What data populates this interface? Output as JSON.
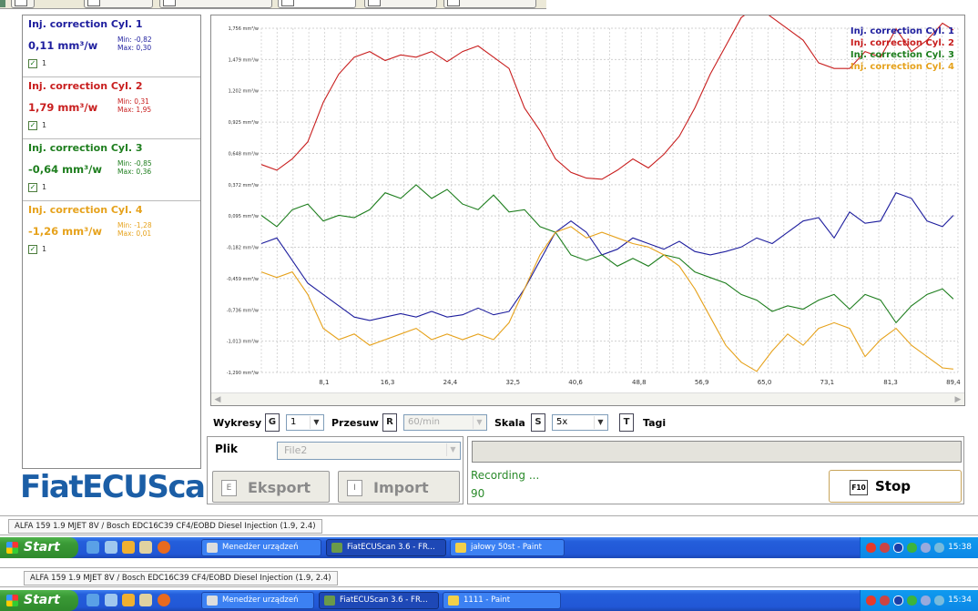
{
  "cylinders": [
    {
      "title": "Inj. correction Cyl. 1",
      "value": "0,11 mm³/w",
      "min": "Min: -0,82",
      "max": "Max: 0,30",
      "checked_label": "1",
      "color": "#1e1e9e"
    },
    {
      "title": "Inj. correction Cyl. 2",
      "value": "1,79 mm³/w",
      "min": "Min: 0,31",
      "max": "Max: 1,95",
      "checked_label": "1",
      "color": "#c81e1e"
    },
    {
      "title": "Inj. correction Cyl. 3",
      "value": "-0,64 mm³/w",
      "min": "Min: -0,85",
      "max": "Max: 0,36",
      "checked_label": "1",
      "color": "#1e7e1e"
    },
    {
      "title": "Inj. correction Cyl. 4",
      "value": "-1,26 mm³/w",
      "min": "Min: -1,28",
      "max": "Max: 0,01",
      "checked_label": "1",
      "color": "#e6a21c"
    }
  ],
  "logo": "FiatECUScan",
  "controls": {
    "wykresy_label": "Wykresy",
    "wykresy_key": "G",
    "wykresy_value": "1",
    "przesuw_label": "Przesuw",
    "przesuw_key": "R",
    "przesuw_value": "60/min",
    "skala_label": "Skala",
    "skala_key": "S",
    "skala_value": "5x",
    "tagi_key": "T",
    "tagi_label": "Tagi"
  },
  "file": {
    "label": "Plik",
    "value": "File2",
    "export_key": "E",
    "export_label": "Eksport",
    "import_key": "I",
    "import_label": "Import"
  },
  "recording": {
    "status": "Recording ...",
    "count": "90",
    "stop_key": "F10",
    "stop_label": "Stop"
  },
  "taskbars": [
    {
      "window_title": "ALFA 159 1.9 MJET 8V / Bosch EDC16C39 CF4/EOBD Diesel Injection (1.9, 2.4)",
      "start": "Start",
      "tasks": [
        "Menedżer urządzeń",
        "FiatECUScan 3.6 - FR...",
        "jałowy 50st - Paint"
      ],
      "clock": "15:38"
    },
    {
      "window_title": "ALFA 159 1.9 MJET 8V / Bosch EDC16C39 CF4/EOBD Diesel Injection (1.9, 2.4)",
      "start": "Start",
      "tasks": [
        "Menedżer urządzeń",
        "FiatECUScan 3.6 - FR...",
        "1111 - Paint"
      ],
      "clock": "15:34"
    }
  ],
  "chart_data": {
    "type": "line",
    "y_ticks": [
      "1,756 mm³/w",
      "1,479 mm³/w",
      "1,202 mm³/w",
      "0,925 mm³/w",
      "0,648 mm³/w",
      "0,372 mm³/w",
      "0,095 mm³/w",
      "-0,182 mm³/w",
      "-0,459 mm³/w",
      "-0,736 mm³/w",
      "-1,013 mm³/w",
      "-1,290 mm³/w"
    ],
    "x_ticks": [
      "8,1",
      "16,3",
      "24,4",
      "32,5",
      "40,6",
      "48,8",
      "56,9",
      "65,0",
      "73,1",
      "81,3",
      "89,4"
    ],
    "ylim": [
      -1.29,
      1.756
    ],
    "xlim": [
      0,
      90
    ],
    "grid": true,
    "legend_position": "top-right",
    "series": [
      {
        "name": "Inj. correction Cyl. 1",
        "color": "#1e1e9e",
        "points": [
          [
            0,
            -0.15
          ],
          [
            2,
            -0.1
          ],
          [
            4,
            -0.3
          ],
          [
            6,
            -0.5
          ],
          [
            8,
            -0.6
          ],
          [
            10,
            -0.7
          ],
          [
            12,
            -0.8
          ],
          [
            14,
            -0.83
          ],
          [
            16,
            -0.8
          ],
          [
            18,
            -0.77
          ],
          [
            20,
            -0.8
          ],
          [
            22,
            -0.75
          ],
          [
            24,
            -0.8
          ],
          [
            26,
            -0.78
          ],
          [
            28,
            -0.72
          ],
          [
            30,
            -0.78
          ],
          [
            32,
            -0.75
          ],
          [
            34,
            -0.55
          ],
          [
            36,
            -0.3
          ],
          [
            38,
            -0.05
          ],
          [
            40,
            0.05
          ],
          [
            42,
            -0.05
          ],
          [
            44,
            -0.25
          ],
          [
            46,
            -0.2
          ],
          [
            48,
            -0.1
          ],
          [
            50,
            -0.15
          ],
          [
            52,
            -0.2
          ],
          [
            54,
            -0.13
          ],
          [
            56,
            -0.22
          ],
          [
            58,
            -0.25
          ],
          [
            60,
            -0.22
          ],
          [
            62,
            -0.18
          ],
          [
            64,
            -0.1
          ],
          [
            66,
            -0.15
          ],
          [
            68,
            -0.05
          ],
          [
            70,
            0.05
          ],
          [
            72,
            0.08
          ],
          [
            74,
            -0.1
          ],
          [
            76,
            0.13
          ],
          [
            78,
            0.03
          ],
          [
            80,
            0.05
          ],
          [
            82,
            0.3
          ],
          [
            84,
            0.25
          ],
          [
            86,
            0.05
          ],
          [
            88,
            0.0
          ],
          [
            89.4,
            0.1
          ]
        ]
      },
      {
        "name": "Inj. correction Cyl. 2",
        "color": "#c81e1e",
        "points": [
          [
            0,
            0.55
          ],
          [
            2,
            0.5
          ],
          [
            4,
            0.6
          ],
          [
            6,
            0.75
          ],
          [
            8,
            1.1
          ],
          [
            10,
            1.35
          ],
          [
            12,
            1.5
          ],
          [
            14,
            1.55
          ],
          [
            16,
            1.47
          ],
          [
            18,
            1.52
          ],
          [
            20,
            1.5
          ],
          [
            22,
            1.55
          ],
          [
            24,
            1.46
          ],
          [
            26,
            1.55
          ],
          [
            28,
            1.6
          ],
          [
            30,
            1.5
          ],
          [
            32,
            1.4
          ],
          [
            34,
            1.05
          ],
          [
            36,
            0.85
          ],
          [
            38,
            0.6
          ],
          [
            40,
            0.48
          ],
          [
            42,
            0.43
          ],
          [
            44,
            0.42
          ],
          [
            46,
            0.5
          ],
          [
            48,
            0.6
          ],
          [
            50,
            0.52
          ],
          [
            52,
            0.64
          ],
          [
            54,
            0.8
          ],
          [
            56,
            1.05
          ],
          [
            58,
            1.35
          ],
          [
            60,
            1.6
          ],
          [
            62,
            1.85
          ],
          [
            64,
            1.95
          ],
          [
            66,
            1.85
          ],
          [
            68,
            1.75
          ],
          [
            70,
            1.65
          ],
          [
            72,
            1.45
          ],
          [
            74,
            1.4
          ],
          [
            76,
            1.4
          ],
          [
            78,
            1.55
          ],
          [
            80,
            1.5
          ],
          [
            82,
            1.75
          ],
          [
            84,
            1.55
          ],
          [
            86,
            1.65
          ],
          [
            88,
            1.8
          ],
          [
            89.4,
            1.74
          ]
        ]
      },
      {
        "name": "Inj. correction Cyl. 3",
        "color": "#1e7e1e",
        "points": [
          [
            0,
            0.1
          ],
          [
            2,
            0.0
          ],
          [
            4,
            0.15
          ],
          [
            6,
            0.2
          ],
          [
            8,
            0.05
          ],
          [
            10,
            0.1
          ],
          [
            12,
            0.08
          ],
          [
            14,
            0.15
          ],
          [
            16,
            0.3
          ],
          [
            18,
            0.25
          ],
          [
            20,
            0.37
          ],
          [
            22,
            0.25
          ],
          [
            24,
            0.33
          ],
          [
            26,
            0.2
          ],
          [
            28,
            0.15
          ],
          [
            30,
            0.28
          ],
          [
            32,
            0.13
          ],
          [
            34,
            0.15
          ],
          [
            36,
            0.0
          ],
          [
            38,
            -0.05
          ],
          [
            40,
            -0.25
          ],
          [
            42,
            -0.3
          ],
          [
            44,
            -0.25
          ],
          [
            46,
            -0.35
          ],
          [
            48,
            -0.28
          ],
          [
            50,
            -0.35
          ],
          [
            52,
            -0.25
          ],
          [
            54,
            -0.28
          ],
          [
            56,
            -0.4
          ],
          [
            58,
            -0.45
          ],
          [
            60,
            -0.5
          ],
          [
            62,
            -0.6
          ],
          [
            64,
            -0.65
          ],
          [
            66,
            -0.75
          ],
          [
            68,
            -0.7
          ],
          [
            70,
            -0.73
          ],
          [
            72,
            -0.65
          ],
          [
            74,
            -0.6
          ],
          [
            76,
            -0.73
          ],
          [
            78,
            -0.6
          ],
          [
            80,
            -0.65
          ],
          [
            82,
            -0.85
          ],
          [
            84,
            -0.7
          ],
          [
            86,
            -0.6
          ],
          [
            88,
            -0.55
          ],
          [
            89.4,
            -0.64
          ]
        ]
      },
      {
        "name": "Inj. correction Cyl. 4",
        "color": "#e6a21c",
        "points": [
          [
            0,
            -0.4
          ],
          [
            2,
            -0.45
          ],
          [
            4,
            -0.4
          ],
          [
            6,
            -0.6
          ],
          [
            8,
            -0.9
          ],
          [
            10,
            -1.0
          ],
          [
            12,
            -0.95
          ],
          [
            14,
            -1.05
          ],
          [
            16,
            -1.0
          ],
          [
            18,
            -0.95
          ],
          [
            20,
            -0.9
          ],
          [
            22,
            -1.0
          ],
          [
            24,
            -0.95
          ],
          [
            26,
            -1.0
          ],
          [
            28,
            -0.95
          ],
          [
            30,
            -1.0
          ],
          [
            32,
            -0.85
          ],
          [
            34,
            -0.55
          ],
          [
            36,
            -0.25
          ],
          [
            38,
            -0.05
          ],
          [
            40,
            0.0
          ],
          [
            42,
            -0.1
          ],
          [
            44,
            -0.05
          ],
          [
            46,
            -0.1
          ],
          [
            48,
            -0.15
          ],
          [
            50,
            -0.18
          ],
          [
            52,
            -0.25
          ],
          [
            54,
            -0.35
          ],
          [
            56,
            -0.55
          ],
          [
            58,
            -0.8
          ],
          [
            60,
            -1.05
          ],
          [
            62,
            -1.2
          ],
          [
            64,
            -1.28
          ],
          [
            66,
            -1.1
          ],
          [
            68,
            -0.95
          ],
          [
            70,
            -1.05
          ],
          [
            72,
            -0.9
          ],
          [
            74,
            -0.85
          ],
          [
            76,
            -0.9
          ],
          [
            78,
            -1.15
          ],
          [
            80,
            -1.0
          ],
          [
            82,
            -0.9
          ],
          [
            84,
            -1.05
          ],
          [
            86,
            -1.15
          ],
          [
            88,
            -1.25
          ],
          [
            89.4,
            -1.26
          ]
        ]
      }
    ]
  }
}
